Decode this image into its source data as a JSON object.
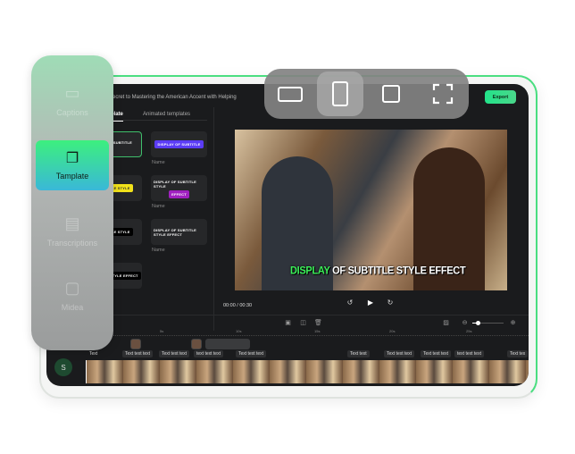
{
  "header": {
    "title": "Secret to Mastering the American Accent with Helping",
    "export_label": "Export"
  },
  "tabs": [
    {
      "label": "Template",
      "active": true
    },
    {
      "label": "Animated templates"
    }
  ],
  "templates": [
    {
      "preview": "DISPLAY OF SUBTITLE EFFECTS",
      "selected": true
    },
    {
      "preview": "DISPLAY OF SUBTITLE",
      "name": "Name",
      "color": "#5b3cf5"
    },
    {
      "preview": "SUBTITLE STYLE",
      "color": "#f2e21a"
    },
    {
      "preview": "DISPLAY OF SUBTITLE STYLE",
      "highlight": "EFFECT",
      "name": "Name"
    },
    {
      "preview": "SUBTITLE STYLE"
    },
    {
      "preview": "DISPLAY OF SUBTITLE STYLE EFFECT",
      "name": "Name"
    },
    {
      "preview": "SUBTITLE STYLE EFFECT"
    }
  ],
  "preview": {
    "subtitle_highlight": "DISPLAY",
    "subtitle_rest": " OF SUBTITLE STYLE EFFECT",
    "time": "00:00 / 00:30"
  },
  "timeline": {
    "ruler": [
      "5s",
      "10s",
      "15s",
      "20s",
      "25s"
    ],
    "text_clips": [
      "Text",
      "Text text text",
      "Text text text",
      "text text text",
      "Text text text",
      "Text text",
      "Text text text",
      "Text text text",
      "text text text",
      "Text tex"
    ],
    "zoom_level": 0.15
  },
  "user": {
    "initial": "S"
  },
  "sidebar": {
    "items": [
      {
        "label": "Captions",
        "icon": "captions-icon"
      },
      {
        "label": "Tamplate",
        "icon": "template-icon",
        "active": true
      },
      {
        "label": "Transcriptions",
        "icon": "transcriptions-icon"
      },
      {
        "label": "Midea",
        "icon": "media-icon"
      }
    ]
  },
  "aspect_toolbar": {
    "options": [
      "landscape",
      "portrait",
      "square",
      "fullscreen"
    ],
    "active": "portrait"
  },
  "colors": {
    "accent": "#3cf07e",
    "export": "#22e38a",
    "subtitle_highlight": "#3cf05a"
  }
}
